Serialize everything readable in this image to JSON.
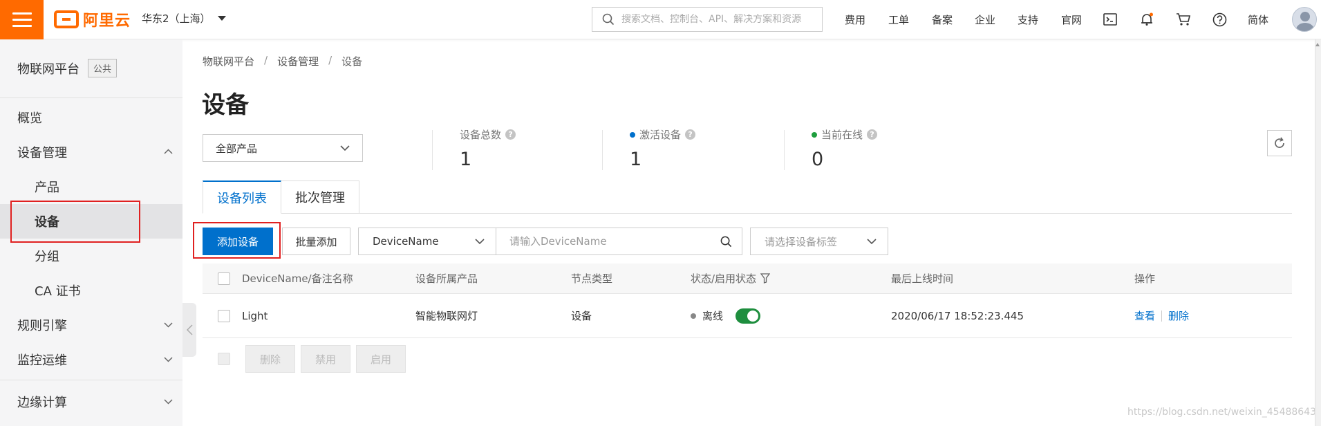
{
  "topbar": {
    "logo_text": "阿里云",
    "region": "华东2（上海）",
    "search_placeholder": "搜索文档、控制台、API、解决方案和资源",
    "nav": [
      "费用",
      "工单",
      "备案",
      "企业",
      "支持",
      "官网"
    ],
    "language": "简体"
  },
  "sidebar": {
    "title": "物联网平台",
    "badge": "公共",
    "items": [
      {
        "label": "概览"
      },
      {
        "label": "设备管理"
      },
      {
        "label": "产品"
      },
      {
        "label": "设备"
      },
      {
        "label": "分组"
      },
      {
        "label": "CA 证书"
      },
      {
        "label": "规则引擎"
      },
      {
        "label": "监控运维"
      },
      {
        "label": "边缘计算"
      }
    ]
  },
  "breadcrumb": [
    "物联网平台",
    "设备管理",
    "设备"
  ],
  "breadcrumb_sep": "/",
  "page_title": "设备",
  "product_filter": "全部产品",
  "stats": [
    {
      "label": "设备总数",
      "value": "1"
    },
    {
      "label": "激活设备",
      "value": "1",
      "dot_color": "#0070cc"
    },
    {
      "label": "当前在线",
      "value": "0",
      "dot_color": "#1e9e3e"
    }
  ],
  "tabs": [
    "设备列表",
    "批次管理"
  ],
  "toolbar": {
    "add_device": "添加设备",
    "batch_add": "批量添加",
    "field_select": "DeviceName",
    "search_placeholder": "请输入DeviceName",
    "tag_placeholder": "请选择设备标签"
  },
  "table": {
    "columns": [
      "DeviceName/备注名称",
      "设备所属产品",
      "节点类型",
      "状态/启用状态",
      "最后上线时间",
      "操作"
    ],
    "rows": [
      {
        "device_name": "Light",
        "product": "智能物联网灯",
        "node_type": "设备",
        "status": "离线",
        "enabled": true,
        "last_online": "2020/06/17 18:52:23.445",
        "actions": [
          "查看",
          "删除"
        ]
      }
    ]
  },
  "bulk_actions": [
    "删除",
    "禁用",
    "启用"
  ],
  "watermark": "https://blog.csdn.net/weixin_45488643",
  "colors": {
    "brand": "#ff6a00",
    "primary": "#0070cc",
    "online": "#1e9e3e",
    "toggle_on": "#1e8e3e",
    "highlight_box": "#e02020"
  }
}
